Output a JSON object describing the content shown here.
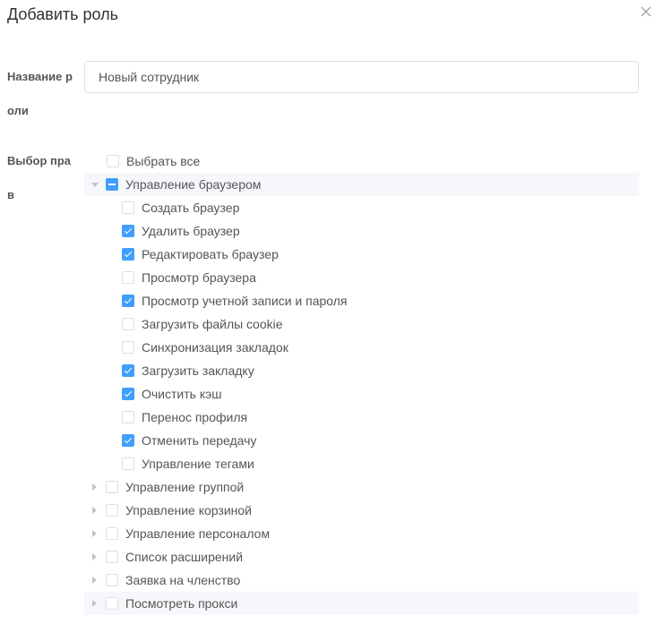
{
  "dialog": {
    "title": "Добавить роль",
    "close_icon": "close-icon"
  },
  "form": {
    "name_label": "Название роли",
    "name_value": "Новый сотрудник",
    "perm_label": "Выбор прав"
  },
  "tree": {
    "select_all": {
      "label": "Выбрать все",
      "checked": false
    },
    "groups": [
      {
        "label": "Управление браузером",
        "state": "indeterminate",
        "expanded": true,
        "children": [
          {
            "label": "Создать браузер",
            "checked": false
          },
          {
            "label": "Удалить браузер",
            "checked": true
          },
          {
            "label": "Редактировать браузер",
            "checked": true
          },
          {
            "label": "Просмотр браузера",
            "checked": false
          },
          {
            "label": "Просмотр учетной записи и пароля",
            "checked": true
          },
          {
            "label": "Загрузить файлы cookie",
            "checked": false
          },
          {
            "label": "Синхронизация закладок",
            "checked": false
          },
          {
            "label": "Загрузить закладку",
            "checked": true
          },
          {
            "label": "Очистить кэш",
            "checked": true
          },
          {
            "label": "Перенос профиля",
            "checked": false
          },
          {
            "label": "Отменить передачу",
            "checked": true
          },
          {
            "label": "Управление тегами",
            "checked": false
          }
        ]
      },
      {
        "label": "Управление группой",
        "state": "unchecked",
        "expanded": false,
        "children": []
      },
      {
        "label": "Управление корзиной",
        "state": "unchecked",
        "expanded": false,
        "children": []
      },
      {
        "label": "Управление персоналом",
        "state": "unchecked",
        "expanded": false,
        "children": []
      },
      {
        "label": "Список расширений",
        "state": "unchecked",
        "expanded": false,
        "children": []
      },
      {
        "label": "Заявка на членство",
        "state": "unchecked",
        "expanded": false,
        "children": []
      },
      {
        "label": "Посмотреть прокси",
        "state": "unchecked",
        "expanded": false,
        "children": []
      }
    ]
  },
  "colors": {
    "primary": "#409eff",
    "border": "#dcdfe6",
    "hover_bg": "#f5f7fa"
  }
}
